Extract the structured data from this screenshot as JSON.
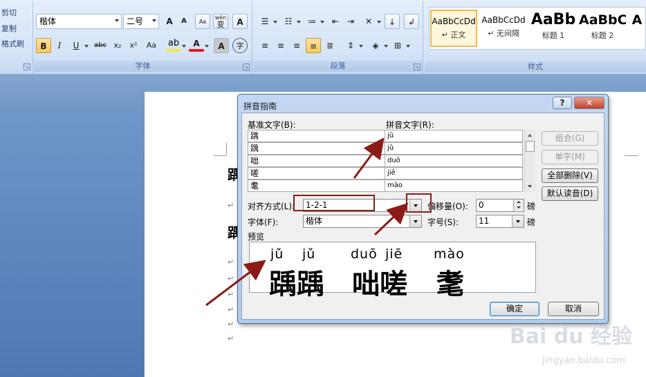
{
  "ribbon": {
    "clipboard": {
      "cut": "剪切",
      "copy": "复制",
      "format_painter": "格式刷"
    },
    "font": {
      "font_name": "楷体",
      "font_size": "二号",
      "group_label": "字体",
      "grow": "A",
      "shrink": "A",
      "bold": "B",
      "italic": "I",
      "underline": "U",
      "strike": "abc",
      "subscript": "x₂",
      "superscript": "x²",
      "change_case": "Aa",
      "font_color": "A",
      "char_shading": "A",
      "enclose": "字",
      "phonetic_guide": "wén",
      "phonetic_guide_char": "变",
      "char_border": "A"
    },
    "paragraph": {
      "group_label": "段落"
    },
    "styles": {
      "group_label": "样式",
      "items": [
        {
          "sample": "AaBbCcDd",
          "name": "↵ 正文"
        },
        {
          "sample": "AaBbCcDd",
          "name": "↵ 无间隔"
        },
        {
          "sample": "AaBb",
          "name": "标题 1"
        },
        {
          "sample": "AaBbC",
          "name": "标题 2"
        },
        {
          "sample": "A",
          "name": ""
        }
      ]
    }
  },
  "document": {
    "chars": [
      "踽",
      "踽"
    ],
    "para_mark": "↵"
  },
  "dialog": {
    "title": "拼音指南",
    "help_button": "?",
    "close_button": "✕",
    "base_text_label": "基准文字(B):",
    "ruby_text_label": "拼音文字(R):",
    "rows": [
      {
        "base": "踽",
        "ruby": "jǔ"
      },
      {
        "base": "踽",
        "ruby": "jǔ"
      },
      {
        "base": "咄",
        "ruby": "duō"
      },
      {
        "base": "嗟",
        "ruby": "jiē"
      },
      {
        "base": "耄",
        "ruby": "mào"
      }
    ],
    "buttons": {
      "group": "组合(G)",
      "mono": "单字(M)",
      "clear_all": "全部删除(V)",
      "default_reading": "默认读音(D)",
      "ok": "确定",
      "cancel": "取消"
    },
    "alignment_label": "对齐方式(L):",
    "alignment_value": "1-2-1",
    "offset_label": "偏移量(O):",
    "offset_value": "0",
    "offset_unit": "磅",
    "font_label": "字体(F):",
    "font_value": "楷体",
    "size_label": "字号(S):",
    "size_value": "11",
    "size_unit": "磅",
    "preview_label": "预览",
    "preview": {
      "pinyin": [
        "jǔ",
        "jǔ",
        "duō",
        "jiē",
        "mào"
      ],
      "hanzi": [
        "踽踽",
        "咄嗟",
        "耄"
      ]
    }
  },
  "watermark": {
    "brand": "Bai du 经验",
    "url": "jingyan.baidu.com"
  },
  "colors": {
    "annotation": "#8c1a17",
    "ribbon_bg": "#d6e4f7",
    "dialog_frame": "#b4cbea"
  }
}
